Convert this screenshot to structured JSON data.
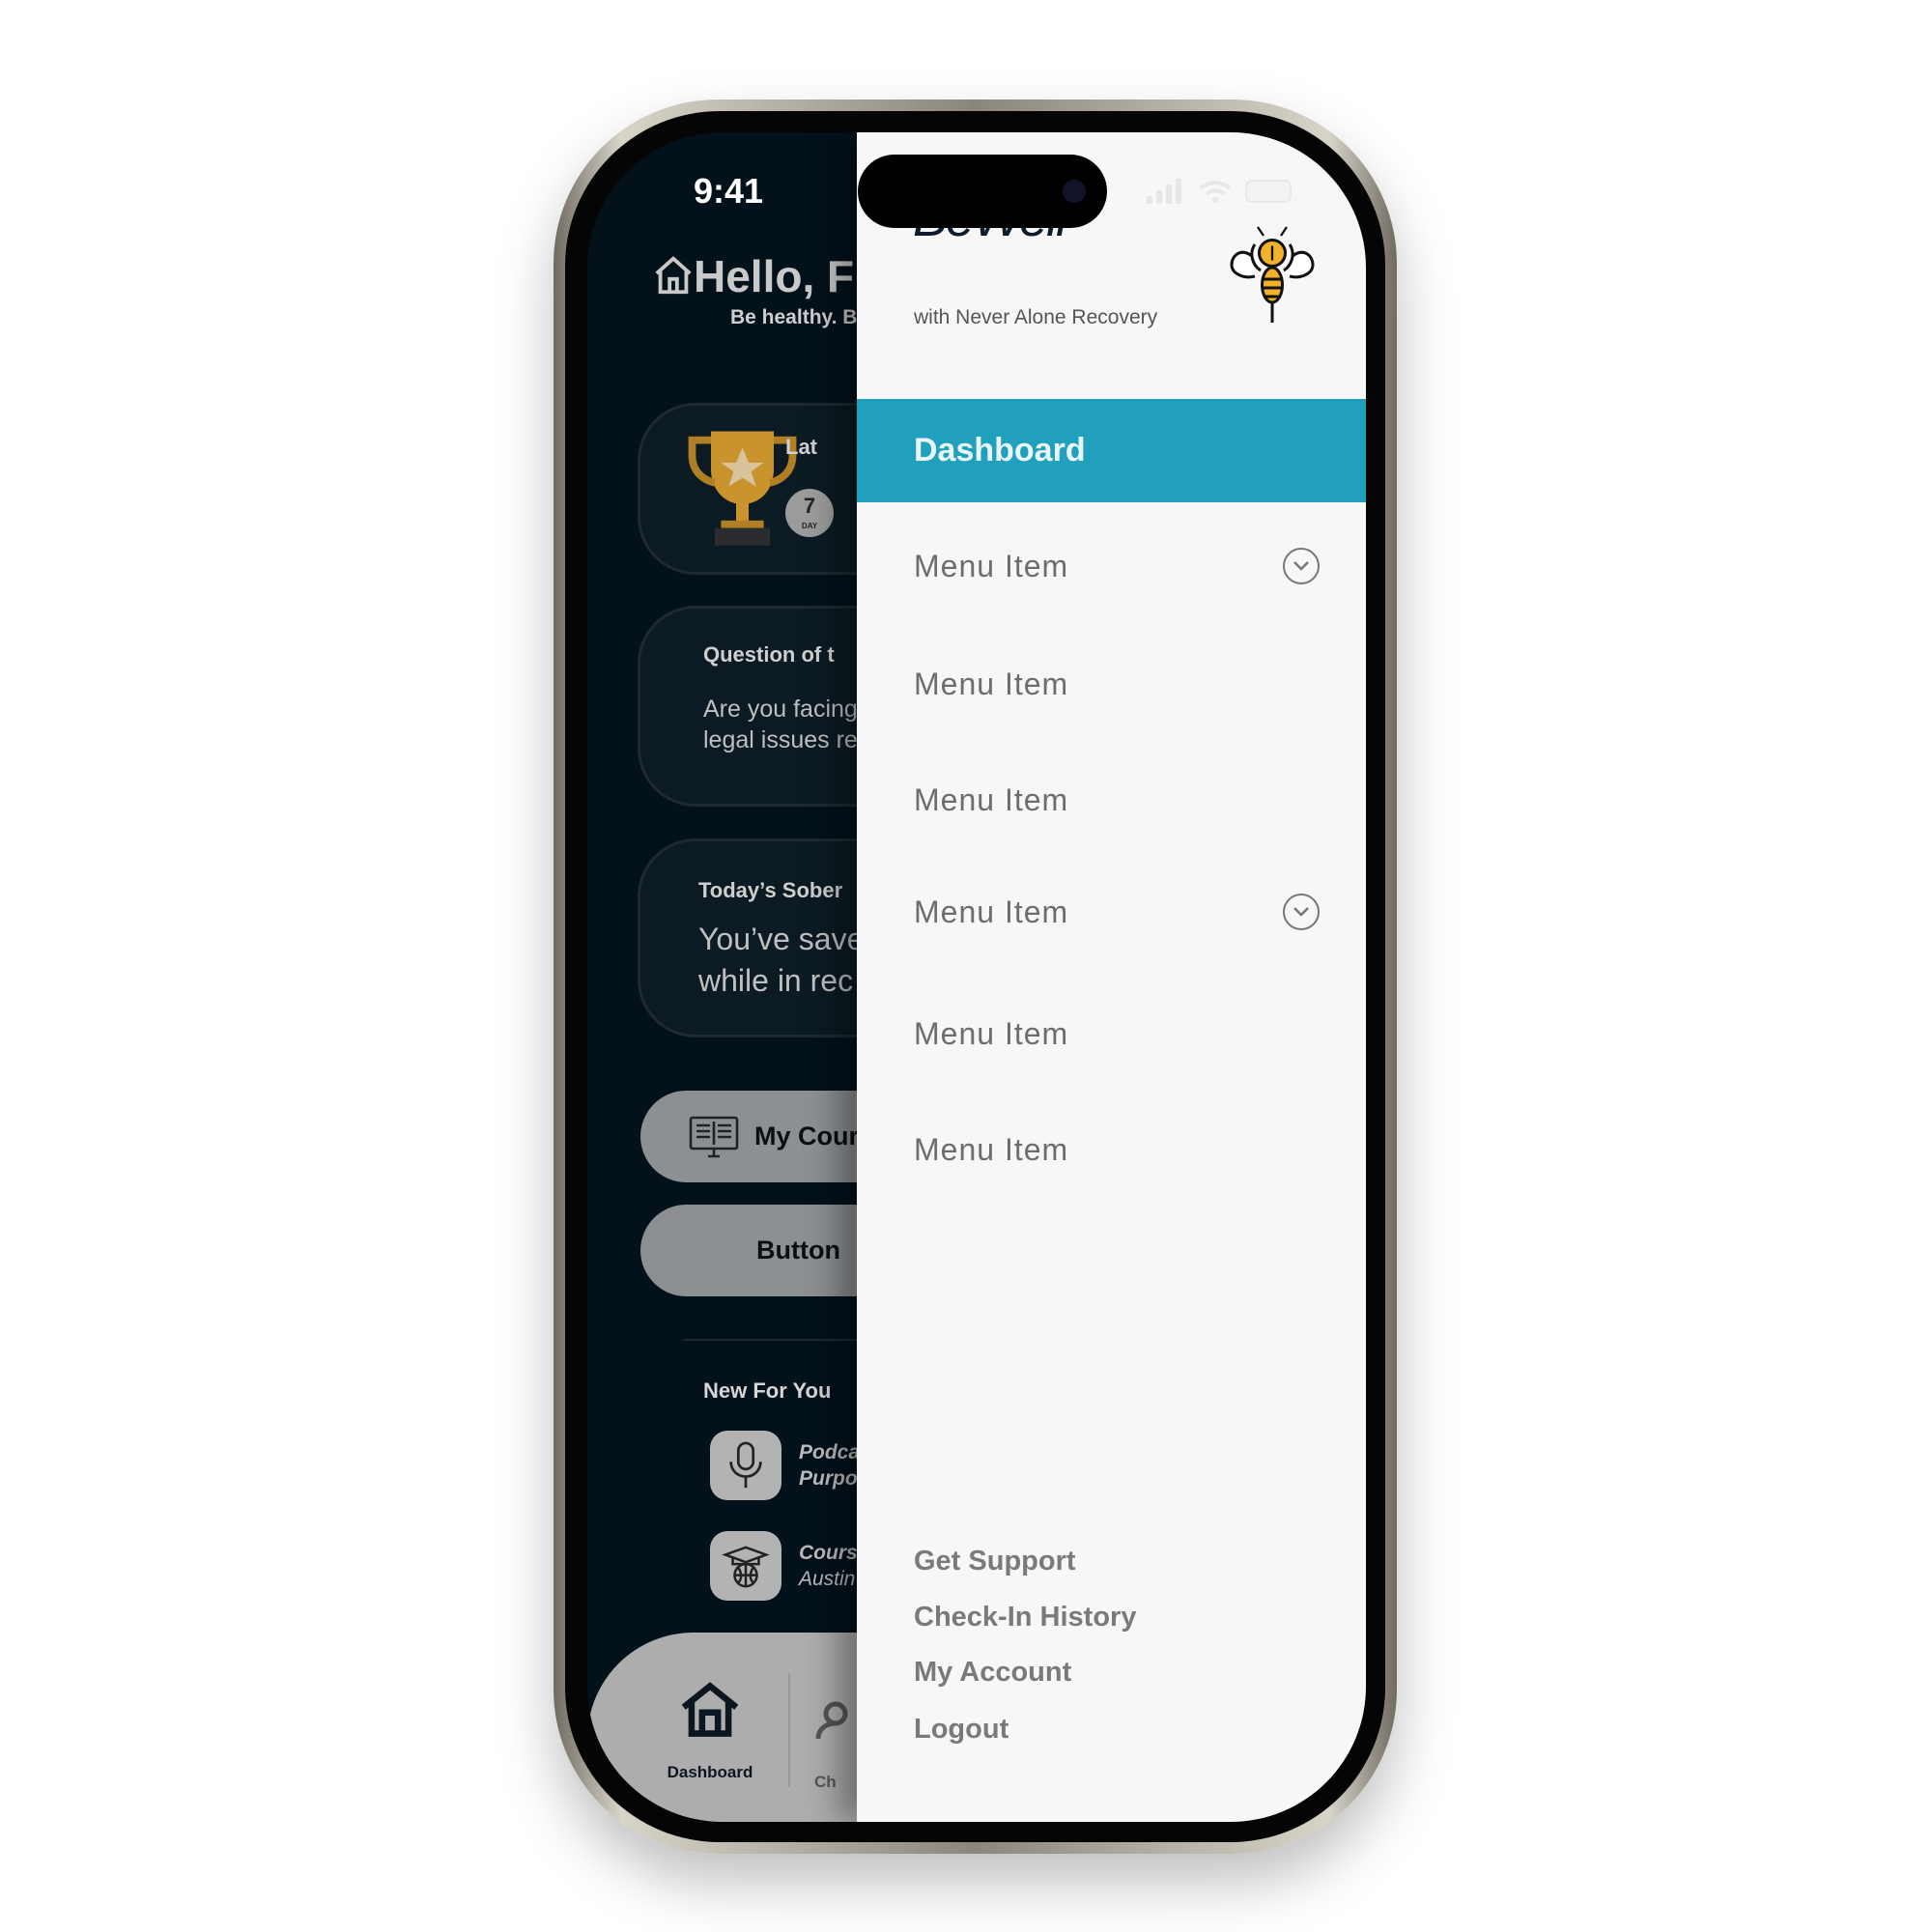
{
  "status_bar": {
    "time": "9:41"
  },
  "background_screen": {
    "greeting": "Hello, F",
    "subtitle": "Be healthy. Be w",
    "achievement_card": {
      "label": "Lat",
      "badge": "7",
      "badge_unit": "DAY"
    },
    "question_card": {
      "title": "Question of t",
      "text_line1": "Are you facing",
      "text_line2": "legal issues re"
    },
    "sober_card": {
      "title": "Today’s Sober",
      "text_line1": "You’ve save",
      "text_line2": "while in rec"
    },
    "courses_button": "My Cour",
    "generic_button": "Button",
    "new_for_you": {
      "title": "New For You",
      "items": [
        {
          "line1": "Podca",
          "line2": "Purpo",
          "icon": "microphone-icon"
        },
        {
          "line1": "Cours",
          "line2": "Austin",
          "icon": "graduation-globe-icon"
        }
      ]
    },
    "tab_bar": {
      "tabs": [
        {
          "label": "Dashboard",
          "icon": "home-icon"
        },
        {
          "label": "Ch",
          "icon": "person-icon"
        }
      ]
    }
  },
  "drawer": {
    "brand": "BeWell",
    "tagline": "with Never Alone Recovery",
    "active_item": "Dashboard",
    "menu_items": [
      {
        "label": "Menu Item",
        "expandable": true
      },
      {
        "label": "Menu Item",
        "expandable": false
      },
      {
        "label": "Menu Item",
        "expandable": false
      },
      {
        "label": "Menu Item",
        "expandable": true
      },
      {
        "label": "Menu Item",
        "expandable": false
      },
      {
        "label": "Menu Item",
        "expandable": false
      }
    ],
    "footer_links": [
      "Get Support",
      "Check-In History",
      "My Account",
      "Logout"
    ]
  },
  "colors": {
    "accent": "#21a0bd",
    "dark_bg": "#03111b",
    "drawer_bg": "#f7f7f7"
  }
}
